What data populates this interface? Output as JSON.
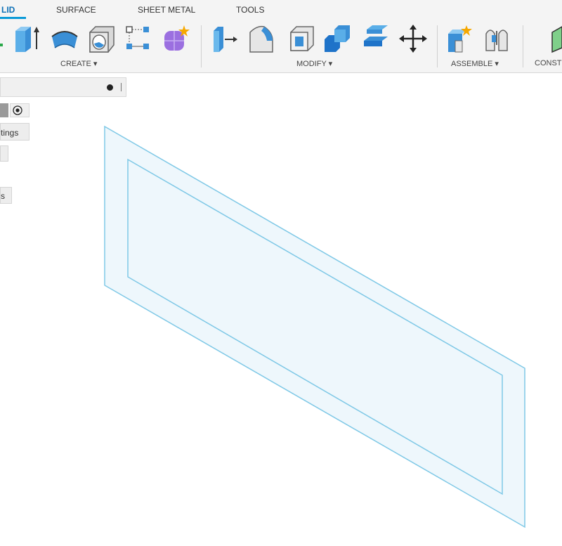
{
  "tabs": [
    {
      "label": "LID",
      "active": true
    },
    {
      "label": "SURFACE",
      "active": false
    },
    {
      "label": "SHEET METAL",
      "active": false
    },
    {
      "label": "TOOLS",
      "active": false
    }
  ],
  "groups": {
    "create": "CREATE ▾",
    "modify": "MODIFY ▾",
    "assemble": "ASSEMBLE ▾",
    "construct": "CONST"
  },
  "browser": {
    "settings_label": "tings",
    "item_label": "s"
  },
  "colors": {
    "accent": "#0b9ad8",
    "tab_active": "#0b6fb6",
    "icon_blue": "#3a8fd6",
    "sketch_fill": "#eef7fc",
    "sketch_stroke": "#7ec8e6"
  }
}
